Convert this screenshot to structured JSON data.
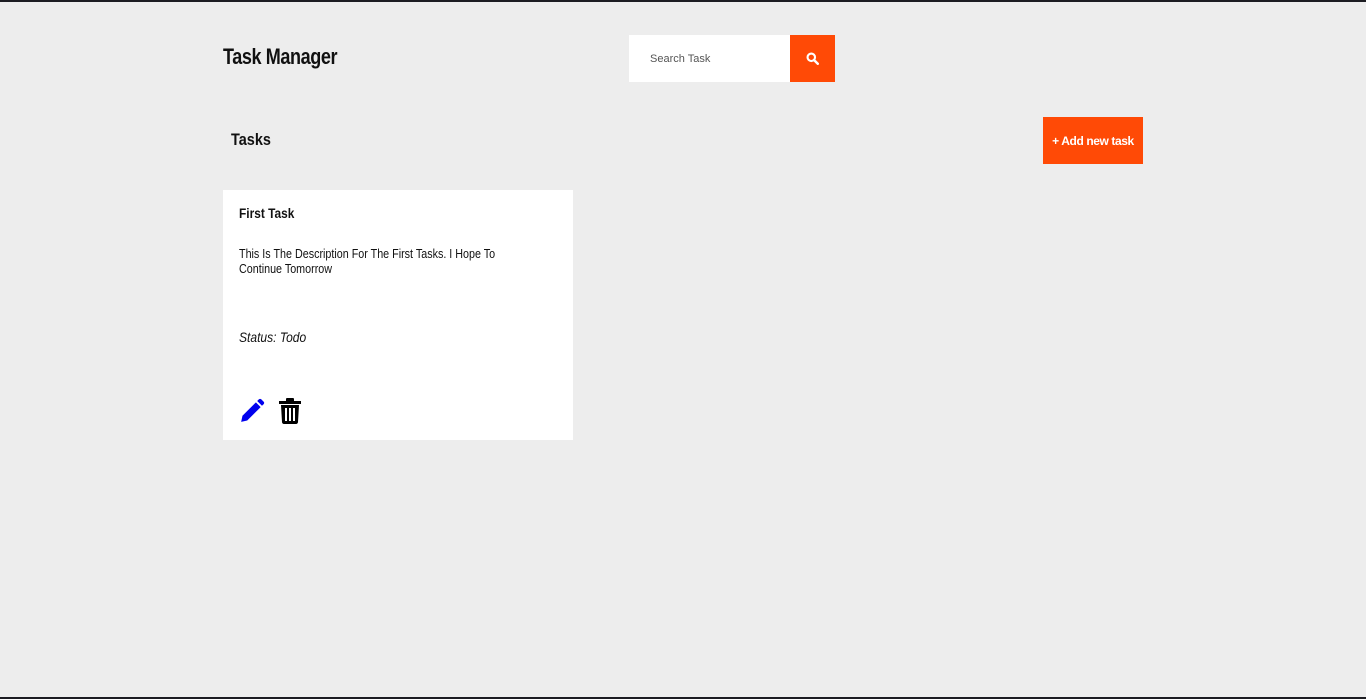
{
  "header": {
    "app_title": "Task Manager",
    "search": {
      "placeholder": "Search Task",
      "value": "",
      "icon": "search-icon"
    }
  },
  "tasks_section": {
    "title": "Tasks",
    "add_button_label": "+ Add new task"
  },
  "tasks": [
    {
      "title": "First Task",
      "description": "This Is The Description For The First Tasks. I Hope To Continue Tomorrow",
      "status": "Status: Todo",
      "edit_icon": "pencil-icon",
      "delete_icon": "trash-icon"
    }
  ],
  "colors": {
    "accent": "#ff4a06",
    "background": "#ededed",
    "card": "#ffffff",
    "edit_icon": "#0000ee",
    "text": "#111111"
  }
}
